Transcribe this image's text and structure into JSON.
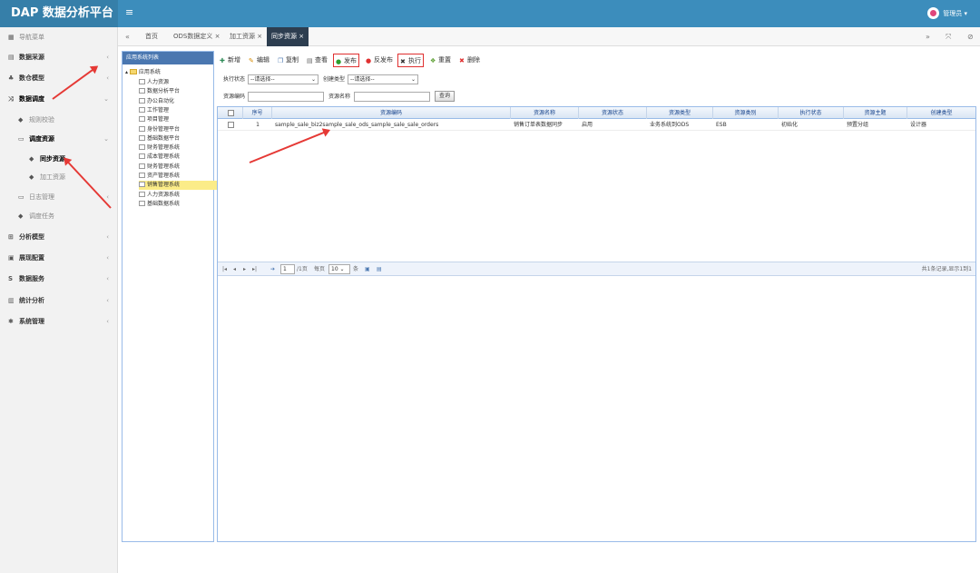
{
  "app": {
    "title": "DAP  数据分析平台",
    "menu_icon": "hamburger-icon",
    "user": "管理员 ▾",
    "avatar_color": "#e0457b"
  },
  "colors": {
    "header": "#3c8dbc",
    "brand": "#367fa9",
    "active_tab": "#2d3e50",
    "annotation": "#e53935"
  },
  "sidebar": {
    "heading": "导航菜单",
    "items": [
      {
        "label": "数据采源",
        "icon": "database-icon"
      },
      {
        "label": "数仓模型",
        "icon": "layers-icon"
      },
      {
        "label": "数据调度",
        "icon": "shuffle-icon"
      },
      {
        "label": "规则校验",
        "icon": "tag-icon"
      },
      {
        "label": "调度资源",
        "icon": "folder-icon"
      },
      {
        "label": "同步资源",
        "icon": "tag-icon"
      },
      {
        "label": "加工资源",
        "icon": "tag-icon"
      },
      {
        "label": "日志管理",
        "icon": "folder-icon"
      },
      {
        "label": "调度任务",
        "icon": "tag-icon"
      },
      {
        "label": "分析模型",
        "icon": "chart-icon"
      },
      {
        "label": "展现配置",
        "icon": "monitor-icon"
      },
      {
        "label": "数据服务",
        "icon": "dollar-icon"
      },
      {
        "label": "统计分析",
        "icon": "bar-chart-icon"
      },
      {
        "label": "系统管理",
        "icon": "gear-icon"
      }
    ]
  },
  "tabs": [
    {
      "label": "首页"
    },
    {
      "label": "ODS数据定义 ×"
    },
    {
      "label": "加工资源 ×"
    },
    {
      "label": "同步资源 ×"
    }
  ],
  "left_panel": {
    "title": "应用系统列表",
    "root": "应用系统",
    "nodes": [
      "人力资源",
      "数据分析平台",
      "办公自动化",
      "工作管理",
      "项目管理",
      "身份管理平台",
      "基础数据平台",
      "财务管理系统",
      "成本管理系统",
      "财务管理系统",
      "资产管理系统",
      "销售管理系统",
      "人力资源系统",
      "基础数据系统"
    ]
  },
  "toolbar": {
    "add": "新增",
    "edit": "编辑",
    "copy": "复制",
    "view": "查看",
    "publish": "发布",
    "unpublish": "反发布",
    "execute": "执行",
    "reset": "重置",
    "delete": "删除"
  },
  "filters": {
    "exec_status_label": "执行状态",
    "exec_status_value": "--请选择--",
    "create_type_label": "创建类型",
    "create_type_value": "--请选择--",
    "code_label": "资源编码",
    "name_label": "资源名称",
    "query_button": "查询"
  },
  "grid": {
    "columns": [
      "序号",
      "资源编码",
      "资源名称",
      "资源状态",
      "资源类型",
      "资源类别",
      "执行状态",
      "资源主题",
      "创建类型"
    ],
    "rows": [
      {
        "index": "1",
        "code": "sample_sale_biz2sample_sale_ods_sample_sale_sale_orders",
        "name": "销售订单表数据同步",
        "status": "启用",
        "type": "业务系统到ODS",
        "category": "ESB",
        "exec_status": "初始化",
        "topic": "预置分组",
        "create_type": "设计器"
      }
    ]
  },
  "pager": {
    "page_value": "1",
    "total_pages": "/1页",
    "per_page_label": "每页",
    "per_page_value": "10",
    "unit": "条",
    "summary": "共1条记录,显示1到1"
  }
}
